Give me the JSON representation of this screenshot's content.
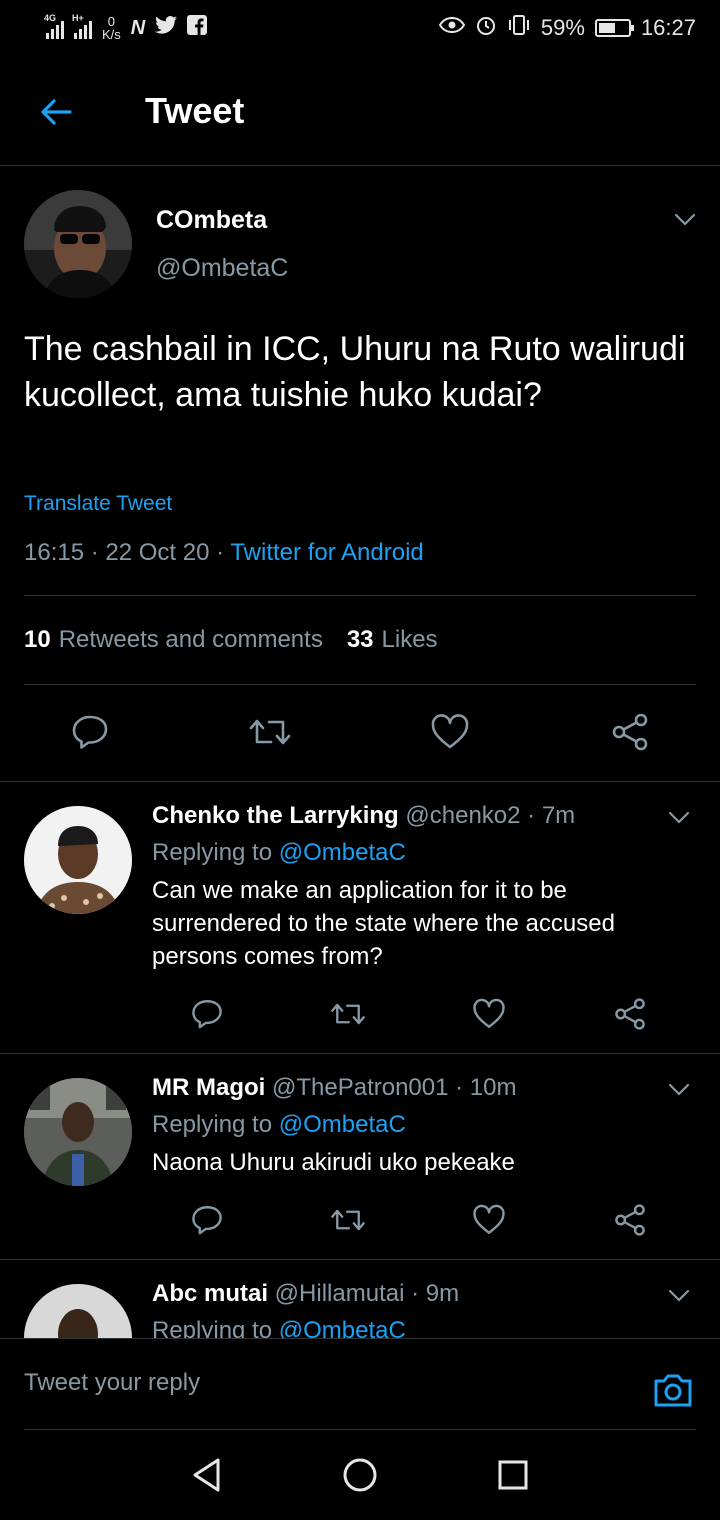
{
  "status_bar": {
    "network_a": "4G",
    "network_b": "H+",
    "speed_value": "0",
    "speed_unit": "K/s",
    "app_icons": [
      "N",
      "twitter-icon",
      "facebook-icon"
    ],
    "battery": "59%",
    "battery_level": 0.59,
    "time": "16:27"
  },
  "header": {
    "title": "Tweet"
  },
  "tweet": {
    "name": "COmbeta",
    "handle": "@OmbetaC",
    "text": "The cashbail in ICC, Uhuru na Ruto walirudi kucollect, ama tuishie huko kudai?",
    "translate": "Translate Tweet",
    "timestamp": "16:15 · 22 Oct 20 · ",
    "source": "Twitter for Android",
    "retweets_count": "10",
    "retweets_label": "Retweets and comments",
    "likes_count": "33",
    "likes_label": "Likes"
  },
  "replies": [
    {
      "name": "Chenko the Larryking",
      "handle_time": " @chenko2 · 7m",
      "replying_prefix": "Replying to ",
      "replying_to": "@OmbetaC",
      "text": "Can we make an application for it to be surrendered to the state where the accused persons comes from?"
    },
    {
      "name": "MR Magoi",
      "handle_time": " @ThePatron001 · 10m",
      "replying_prefix": "Replying to ",
      "replying_to": "@OmbetaC",
      "text": "Naona Uhuru akirudi uko pekeake"
    },
    {
      "name": "Abc mutai",
      "handle_time": " @Hillamutai · 9m",
      "replying_prefix": "Replying to ",
      "replying_to": "@OmbetaC",
      "text": ""
    }
  ],
  "compose": {
    "placeholder": "Tweet your reply"
  },
  "colors": {
    "accent": "#1da1f2",
    "muted": "#8899a6",
    "divider": "#2f3336",
    "background": "#000000"
  }
}
